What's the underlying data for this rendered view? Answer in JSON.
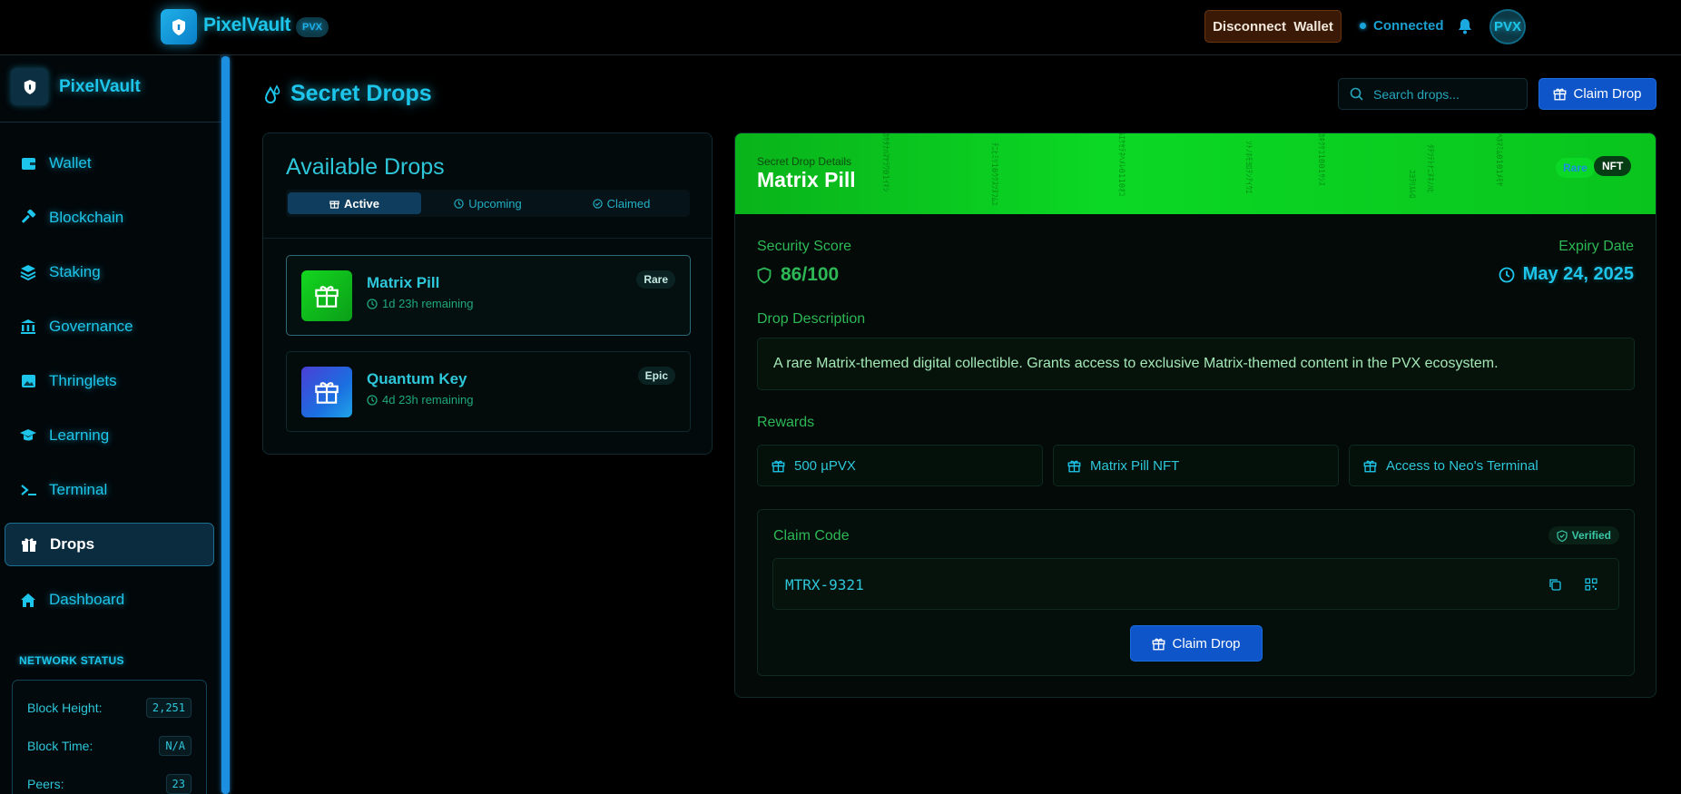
{
  "header": {
    "brand": "PixelVault",
    "token_badge": "PVX",
    "disconnect_label": "Disconnect  Wallet",
    "status": "Connected",
    "avatar": "PVX"
  },
  "sidebar": {
    "brand": "PixelVault",
    "items": [
      {
        "label": "Wallet",
        "icon": "wallet-icon"
      },
      {
        "label": "Blockchain",
        "icon": "hammer-icon"
      },
      {
        "label": "Staking",
        "icon": "layers-icon"
      },
      {
        "label": "Governance",
        "icon": "bank-icon"
      },
      {
        "label": "Thringlets",
        "icon": "image-icon"
      },
      {
        "label": "Learning",
        "icon": "graduation-cap-icon"
      },
      {
        "label": "Terminal",
        "icon": "terminal-icon"
      },
      {
        "label": "Drops",
        "icon": "gift-icon",
        "active": true
      },
      {
        "label": "Dashboard",
        "icon": "home-icon"
      }
    ],
    "network_title": "NETWORK STATUS",
    "network": [
      {
        "label": "Block Height:",
        "value": "2,251"
      },
      {
        "label": "Block Time:",
        "value": "N/A"
      },
      {
        "label": "Peers:",
        "value": "23"
      }
    ]
  },
  "main": {
    "title": "Secret Drops",
    "search_placeholder": "Search drops...",
    "claim_label": "Claim Drop"
  },
  "drops_panel": {
    "title": "Available Drops",
    "tabs": [
      "Active",
      "Upcoming",
      "Claimed"
    ],
    "items": [
      {
        "name": "Matrix Pill",
        "time": "1d 23h remaining",
        "rarity": "Rare"
      },
      {
        "name": "Quantum Key",
        "time": "4d 23h remaining",
        "rarity": "Epic"
      }
    ]
  },
  "detail": {
    "sub_label": "Secret Drop Details",
    "title": "Matrix Pill",
    "rarity": "Rare",
    "type": "NFT",
    "security_label": "Security Score",
    "security_value": "86/100",
    "expiry_label": "Expiry Date",
    "expiry_value": "May 24, 2025",
    "description_label": "Drop Description",
    "description": "A rare Matrix-themed digital collectible. Grants access to exclusive Matrix-themed content in the PVX ecosystem.",
    "rewards_label": "Rewards",
    "rewards": [
      "500 µPVX",
      "Matrix Pill NFT",
      "Access to Neo's Terminal"
    ],
    "claim_code_label": "Claim Code",
    "verified_label": "Verified",
    "claim_code": "MTRX-9321",
    "claim_button": "Claim Drop"
  },
  "colors": {
    "accent": "#1ec5ea",
    "matrix_green": "#0bd824",
    "button_blue": "#0d55c9"
  }
}
